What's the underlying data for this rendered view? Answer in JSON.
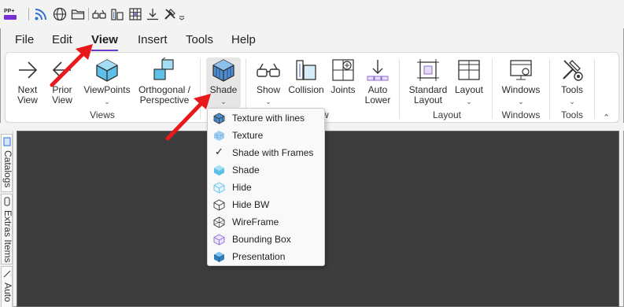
{
  "qat": {
    "app_logo_text": "PP+",
    "icons": [
      "rss-icon",
      "globe-icon",
      "folder-icon",
      "vr-glasses-icon",
      "buildings-icon",
      "grid-icon",
      "download-icon",
      "tools-icon",
      "customize-icon"
    ]
  },
  "menu": {
    "items": [
      {
        "label": "File"
      },
      {
        "label": "Edit"
      },
      {
        "label": "View"
      },
      {
        "label": "Insert"
      },
      {
        "label": "Tools"
      },
      {
        "label": "Help"
      }
    ],
    "active": "View"
  },
  "ribbon": {
    "buttons": {
      "next_view": [
        "Next",
        "View"
      ],
      "prior_view": [
        "Prior",
        "View"
      ],
      "viewpoints": [
        "ViewPoints",
        ""
      ],
      "ortho": [
        "Orthogonal /",
        "Perspective"
      ],
      "shade": [
        "Shade",
        ""
      ],
      "show": [
        "Show",
        ""
      ],
      "collision": [
        "Collision",
        ""
      ],
      "joints": [
        "Joints",
        ""
      ],
      "auto_lower": [
        "Auto",
        "Lower"
      ],
      "standard_layout": [
        "Standard",
        "Layout"
      ],
      "layout": [
        "Layout",
        ""
      ],
      "windows": [
        "Windows",
        ""
      ],
      "tools": [
        "Tools",
        ""
      ]
    },
    "groups": {
      "views": "Views",
      "show_partial": "ow",
      "layout": "Layout",
      "windows": "Windows",
      "tools": "Tools"
    }
  },
  "dock": {
    "tabs": [
      "Catalogs",
      "Extras Items",
      "Auto"
    ]
  },
  "shade_menu": {
    "items": [
      {
        "label": "Texture with lines",
        "icon": "texture-lines-cube-icon",
        "checked": false
      },
      {
        "label": "Texture",
        "icon": "texture-cube-icon",
        "checked": false
      },
      {
        "label": "Shade with Frames",
        "icon": "checkmark-icon",
        "checked": true
      },
      {
        "label": "Shade",
        "icon": "shade-cube-icon",
        "checked": false
      },
      {
        "label": "Hide",
        "icon": "hide-cube-icon",
        "checked": false
      },
      {
        "label": "Hide BW",
        "icon": "hide-bw-cube-icon",
        "checked": false
      },
      {
        "label": "WireFrame",
        "icon": "wireframe-cube-icon",
        "checked": false
      },
      {
        "label": "Bounding Box",
        "icon": "bounding-box-cube-icon",
        "checked": false
      },
      {
        "label": "Presentation",
        "icon": "presentation-cube-icon",
        "checked": false
      }
    ]
  },
  "colors": {
    "accent": "#6a3bc8",
    "annotation_arrow": "#e8191b",
    "workspace": "#3d3d3d"
  }
}
